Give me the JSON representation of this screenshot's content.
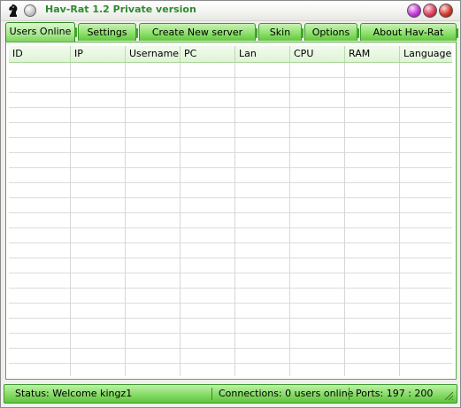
{
  "window": {
    "title": "Hav-Rat 1.2 Private version",
    "icons": {
      "app": "knight-chess-icon",
      "circle": "circle-icon"
    },
    "controls": [
      "minimize-button",
      "maximize-button",
      "close-button"
    ]
  },
  "tabs": [
    {
      "label": "Users Online",
      "active": true
    },
    {
      "label": "Settings",
      "active": false
    },
    {
      "label": "Create New server",
      "active": false
    },
    {
      "label": "Skin",
      "active": false
    },
    {
      "label": "Options",
      "active": false
    },
    {
      "label": "About Hav-Rat",
      "active": false
    }
  ],
  "table": {
    "columns": [
      "ID",
      "IP",
      "Username",
      "PC",
      "Lan",
      "CPU",
      "RAM",
      "Language"
    ],
    "rows": []
  },
  "status": {
    "message": "Status: Welcome kingz1",
    "connections": "Connections: 0 users online",
    "ports": "Ports: 197 : 200"
  },
  "colors": {
    "accent_green": "#62c63f",
    "title_text": "#2e8b2e"
  }
}
